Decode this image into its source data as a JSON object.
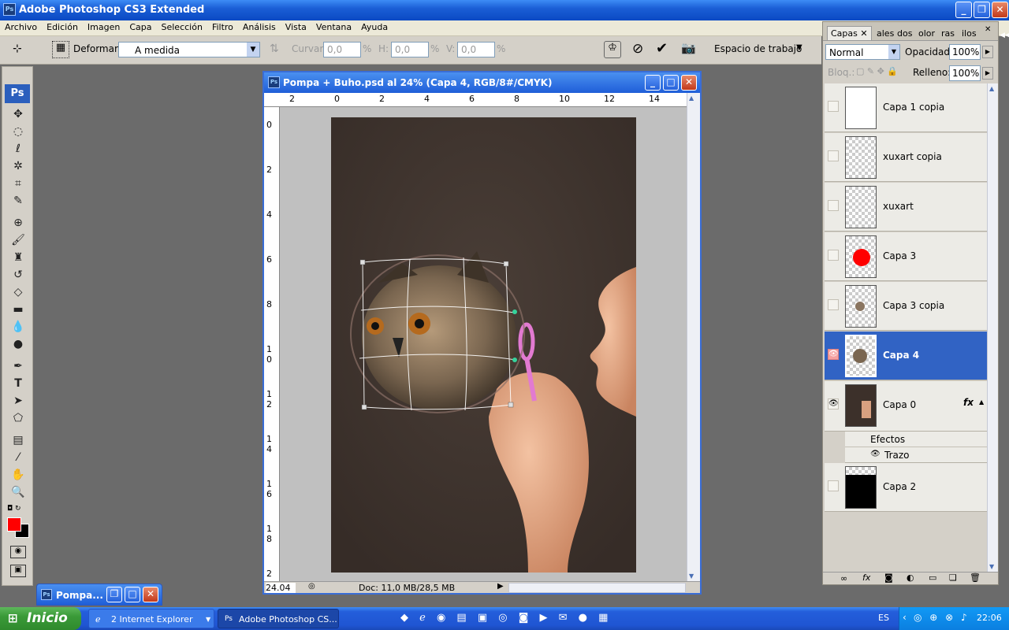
{
  "app": {
    "title": "Adobe Photoshop CS3 Extended",
    "logo": "Ps"
  },
  "menu": [
    "Archivo",
    "Edición",
    "Imagen",
    "Capa",
    "Selección",
    "Filtro",
    "Análisis",
    "Vista",
    "Ventana",
    "Ayuda"
  ],
  "options": {
    "deform_label": "Deformar:",
    "deform_value": "A medida",
    "curve_label": "Curvar:",
    "curve_value": "0,0",
    "curve_unit": "%",
    "h_label": "H:",
    "h_value": "0,0",
    "h_unit": "%",
    "v_label": "V:",
    "v_value": "0,0",
    "v_unit": "%",
    "workspace": "Espacio de trabajo"
  },
  "document": {
    "title": "Pompa + Buho.psd al 24% (Capa 4, RGB/8#/CMYK)",
    "zoom": "24.04",
    "status": "Doc: 11,0 MB/28,5 MB",
    "ruler_h": [
      "2",
      "0",
      "2",
      "4",
      "6",
      "8",
      "10",
      "12",
      "14"
    ],
    "ruler_v": [
      "0",
      "2",
      "4",
      "6",
      "8",
      "1 0",
      "1 2",
      "1 4",
      "1 6",
      "1 8",
      "2"
    ]
  },
  "layers_panel": {
    "tabs": [
      "Capas",
      "ales",
      "dos",
      "olor",
      "ras",
      "ilos"
    ],
    "blend_mode": "Normal",
    "opacity_label": "Opacidad:",
    "opacity_value": "100%",
    "lock_label": "Bloq.:",
    "fill_label": "Relleno:",
    "fill_value": "100%",
    "layers": [
      {
        "name": "Capa 1 copia",
        "visible": false,
        "selected": false
      },
      {
        "name": "xuxart copia",
        "visible": false,
        "selected": false
      },
      {
        "name": "xuxart",
        "visible": false,
        "selected": false
      },
      {
        "name": "Capa 3",
        "visible": false,
        "selected": false
      },
      {
        "name": "Capa 3 copia",
        "visible": false,
        "selected": false
      },
      {
        "name": "Capa 4",
        "visible": true,
        "selected": true
      },
      {
        "name": "Capa 0",
        "visible": true,
        "selected": false,
        "fx": "fx"
      },
      {
        "name": "Capa 2",
        "visible": false,
        "selected": false
      }
    ],
    "effects_label": "Efectos",
    "effect_item": "Trazo"
  },
  "minimized_doc": {
    "label": "Pompa..."
  },
  "taskbar": {
    "start": "Inicio",
    "ie_label": "2 Internet Explorer",
    "ps_label": "Adobe Photoshop CS...",
    "lang": "ES",
    "clock": "22:06"
  },
  "colors": {
    "foreground": "#ff0000",
    "background": "#000000",
    "selection": "#3163c4"
  }
}
